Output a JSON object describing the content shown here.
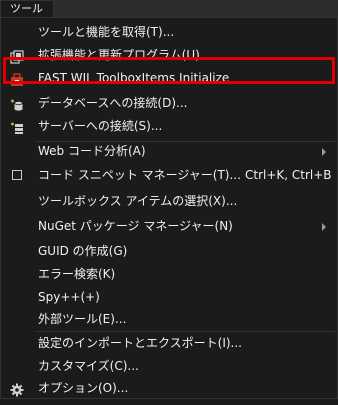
{
  "menubar": {
    "active_tab": "ツール(T)"
  },
  "menu": {
    "items": [
      {
        "label": "ツールと機能を取得(T)..."
      },
      {
        "label": "拡張機能と更新プログラム(U)..."
      },
      {
        "label": "FAST WIL ToolboxItems Initialize"
      },
      {
        "label": "データベースへの接続(D)..."
      },
      {
        "label": "サーバーへの接続(S)..."
      },
      {
        "label": "Web コード分析(A)"
      },
      {
        "label": "コード スニペット マネージャー(T)...",
        "shortcut": "Ctrl+K, Ctrl+B"
      },
      {
        "label": "ツールボックス アイテムの選択(X)..."
      },
      {
        "label": "NuGet パッケージ マネージャー(N)"
      },
      {
        "label": "GUID の作成(G)"
      },
      {
        "label": "エラー検索(K)"
      },
      {
        "label": "Spy++(+)"
      },
      {
        "label": "外部ツール(E)..."
      },
      {
        "label": "設定のインポートとエクスポート(I)..."
      },
      {
        "label": "カスタマイズ(C)..."
      },
      {
        "label": "オプション(O)..."
      }
    ]
  },
  "colors": {
    "menu_background": "#1b1b1c",
    "text": "#f1f1f1",
    "highlight_border": "#e00000",
    "separator": "#333337",
    "icon_accent_green": "#8fd14f"
  },
  "icons": [
    "extensions-icon",
    "build-package-icon",
    "database-connect-icon",
    "server-connect-icon",
    "gear-icon"
  ]
}
